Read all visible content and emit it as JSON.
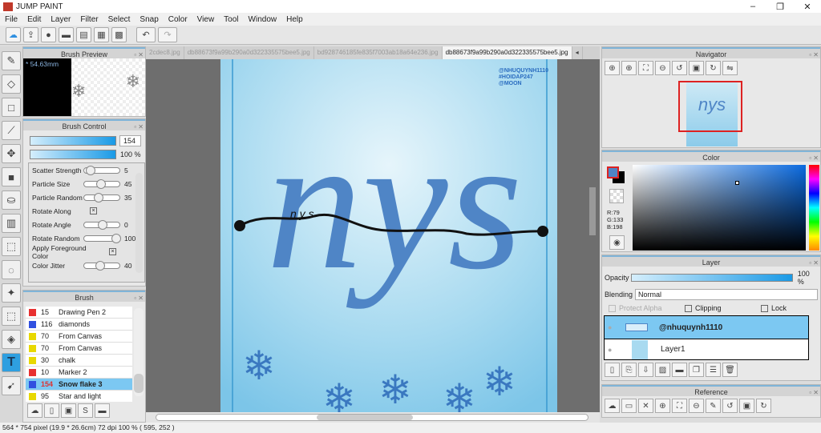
{
  "app": {
    "title": "JUMP PAINT",
    "win_min": "–",
    "win_max": "❐",
    "win_close": "✕"
  },
  "menu": [
    "File",
    "Edit",
    "Layer",
    "Filter",
    "Select",
    "Snap",
    "Color",
    "View",
    "Tool",
    "Window",
    "Help"
  ],
  "tabs": [
    "2cdec8.jpg",
    "db88673f9a99b290a0d322335575bee5.jpg",
    "bd928746185fe835f7003ab18a64e236.jpg",
    "db88673f9a99b290a0d322335575bee5.jpg"
  ],
  "brush_preview": {
    "title": "Brush Preview",
    "size": "* 54.63mm"
  },
  "brush_control": {
    "title": "Brush Control",
    "size": "154",
    "opacity": "100 %",
    "rows": [
      {
        "label": "Scatter Strength",
        "value": "5",
        "pos": 0.05
      },
      {
        "label": "Particle Size",
        "value": "45",
        "pos": 0.45
      },
      {
        "label": "Particle Random",
        "value": "35",
        "pos": 0.35
      },
      {
        "label": "Rotate Along",
        "check": "×"
      },
      {
        "label": "Rotate Angle",
        "value": "0",
        "pos": 0.5
      },
      {
        "label": "Rotate Random",
        "value": "100",
        "pos": 1.0
      },
      {
        "label": "Apply Foreground Color",
        "check": "×"
      },
      {
        "label": "Color Jitter",
        "value": "40",
        "pos": 0.4
      }
    ]
  },
  "brush_list": {
    "title": "Brush",
    "items": [
      {
        "num": "15",
        "name": "Drawing Pen 2",
        "color": "#e83030"
      },
      {
        "num": "116",
        "name": "diamonds",
        "color": "#3050e0"
      },
      {
        "num": "70",
        "name": "From Canvas",
        "color": "#e8d800"
      },
      {
        "num": "70",
        "name": "From Canvas",
        "color": "#e8d800"
      },
      {
        "num": "30",
        "name": "chalk",
        "color": "#e8d800"
      },
      {
        "num": "10",
        "name": "Marker 2",
        "color": "#e83030"
      },
      {
        "num": "154",
        "name": "Snow flake 3",
        "color": "#3050e0",
        "selected": true
      },
      {
        "num": "95",
        "name": "Star and light",
        "color": "#e8d800"
      }
    ]
  },
  "canvas": {
    "watermark": [
      "@NHUQUYNH1110",
      "#HOIDAP247",
      "@MOON"
    ],
    "word": "nys",
    "line_letters": "n  y  s"
  },
  "navigator": {
    "title": "Navigator"
  },
  "color": {
    "title": "Color",
    "r": "R:79",
    "g": "G:133",
    "b": "B:198",
    "fg": "#4f85c6"
  },
  "layer": {
    "title": "Layer",
    "opacity_label": "Opacity",
    "opacity": "100 %",
    "blending_label": "Blending",
    "blending": "Normal",
    "protect_alpha": "Protect Alpha",
    "clipping": "Clipping",
    "lock": "Lock",
    "layers": [
      {
        "name": "@nhuquynh1110",
        "selected": true
      },
      {
        "name": "Layer1"
      }
    ]
  },
  "reference": {
    "title": "Reference"
  },
  "status": "564 * 754 pixel   (19.9 * 26.6cm)   72 dpi   100 %   ( 595, 252 )"
}
